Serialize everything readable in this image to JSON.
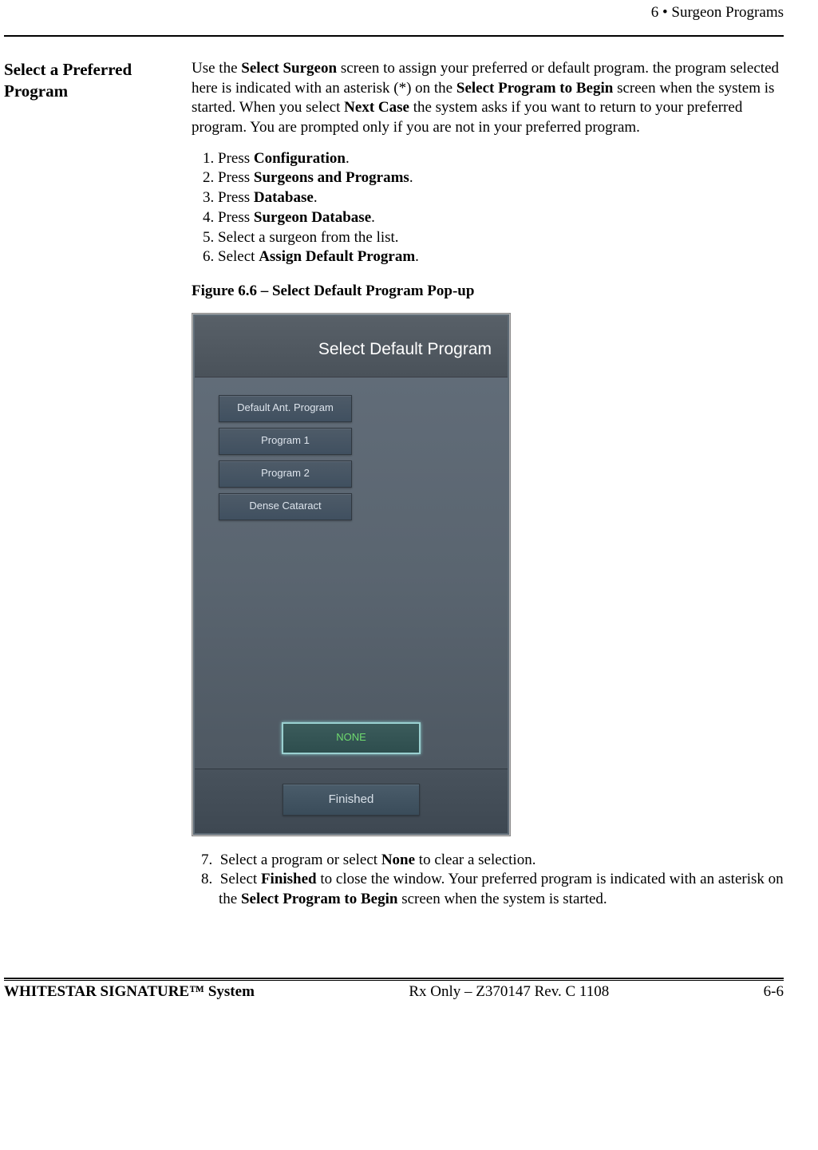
{
  "header": {
    "chapter": "6  • Surgeon Programs"
  },
  "sidebar": {
    "title_line1": "Select a Preferred",
    "title_line2": "Program"
  },
  "intro": {
    "p1a": "Use the ",
    "b1": "Select Surgeon",
    "p1b": " screen to assign your preferred or default program. the program selected here is indicated with an asterisk (*) on the ",
    "b2": "Select Program to Begin",
    "p1c": " screen when the system is started. When you select ",
    "b3": "Next Case",
    "p1d": " the system asks if you want to return to your preferred program. You are prompted only if you are not in your preferred program."
  },
  "steps_top": [
    {
      "pre": "Press ",
      "bold": "Configuration",
      "post": "."
    },
    {
      "pre": "Press ",
      "bold": "Surgeons and Programs",
      "post": "."
    },
    {
      "pre": "Press ",
      "bold": "Database",
      "post": "."
    },
    {
      "pre": "Press ",
      "bold": "Surgeon Database",
      "post": "."
    },
    {
      "pre": "Select a surgeon from the list.",
      "bold": "",
      "post": ""
    },
    {
      "pre": "Select ",
      "bold": "Assign Default Program",
      "post": "."
    }
  ],
  "figure_caption": "Figure 6.6 – Select Default Program Pop-up",
  "popup": {
    "title": "Select Default Program",
    "programs": [
      "Default Ant. Program",
      "Program 1",
      "Program 2",
      "Dense Cataract"
    ],
    "none_label": "NONE",
    "finished_label": "Finished"
  },
  "steps_bottom": [
    {
      "n": "7.",
      "pre": "Select a program or select ",
      "bold": "None",
      "post": " to clear a selection."
    },
    {
      "n": "8.",
      "pre": "Select ",
      "bold": "Finished",
      "post": " to close the window. Your preferred program is indicated with an asterisk on the ",
      "bold2": "Select Program to Begin",
      "post2": " screen when the system is started."
    }
  ],
  "footer": {
    "left": "WHITESTAR SIGNATURE™ System",
    "center": "Rx Only – Z370147 Rev. C 1108",
    "right": "6-6"
  }
}
